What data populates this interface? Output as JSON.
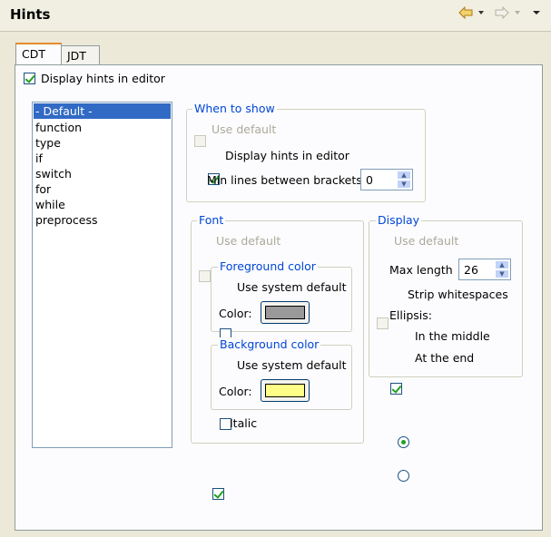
{
  "header": {
    "title": "Hints"
  },
  "tabs": [
    {
      "label": "CDT",
      "active": true
    },
    {
      "label": "JDT",
      "active": false
    }
  ],
  "display_hints_top": {
    "label": "Display hints in editor",
    "checked": true
  },
  "list": {
    "items": [
      "- Default -",
      "function",
      "type",
      "if",
      "switch",
      "for",
      "while",
      "preprocess"
    ],
    "selected_index": 0
  },
  "when_to_show": {
    "title": "When to show",
    "use_default": {
      "label": "Use default",
      "checked": false,
      "enabled": false
    },
    "display_hints": {
      "label": "Display hints in editor",
      "checked": true
    },
    "min_lines": {
      "label": "Min lines between brackets",
      "value": "0"
    }
  },
  "font": {
    "title": "Font",
    "use_default": {
      "label": "Use default",
      "checked": false,
      "enabled": false
    },
    "foreground": {
      "title": "Foreground color",
      "use_system_default": {
        "label": "Use system default",
        "checked": false
      },
      "color_label": "Color:",
      "color": "#999999"
    },
    "background": {
      "title": "Background color",
      "use_system_default": {
        "label": "Use system default",
        "checked": false
      },
      "color_label": "Color:",
      "color": "#ffff88"
    },
    "italic": {
      "label": "Italic",
      "checked": true
    }
  },
  "display": {
    "title": "Display",
    "use_default": {
      "label": "Use default",
      "checked": false,
      "enabled": false
    },
    "max_length": {
      "label": "Max length",
      "value": "26"
    },
    "strip_whitespaces": {
      "label": "Strip whitespaces",
      "checked": true
    },
    "ellipsis": {
      "label": "Ellipsis:",
      "options": [
        {
          "label": "In the middle",
          "selected": true
        },
        {
          "label": "At the end",
          "selected": false
        }
      ]
    }
  },
  "colors": {
    "accent": "#0046d5",
    "selection": "#316ac5",
    "check": "#21a121"
  }
}
